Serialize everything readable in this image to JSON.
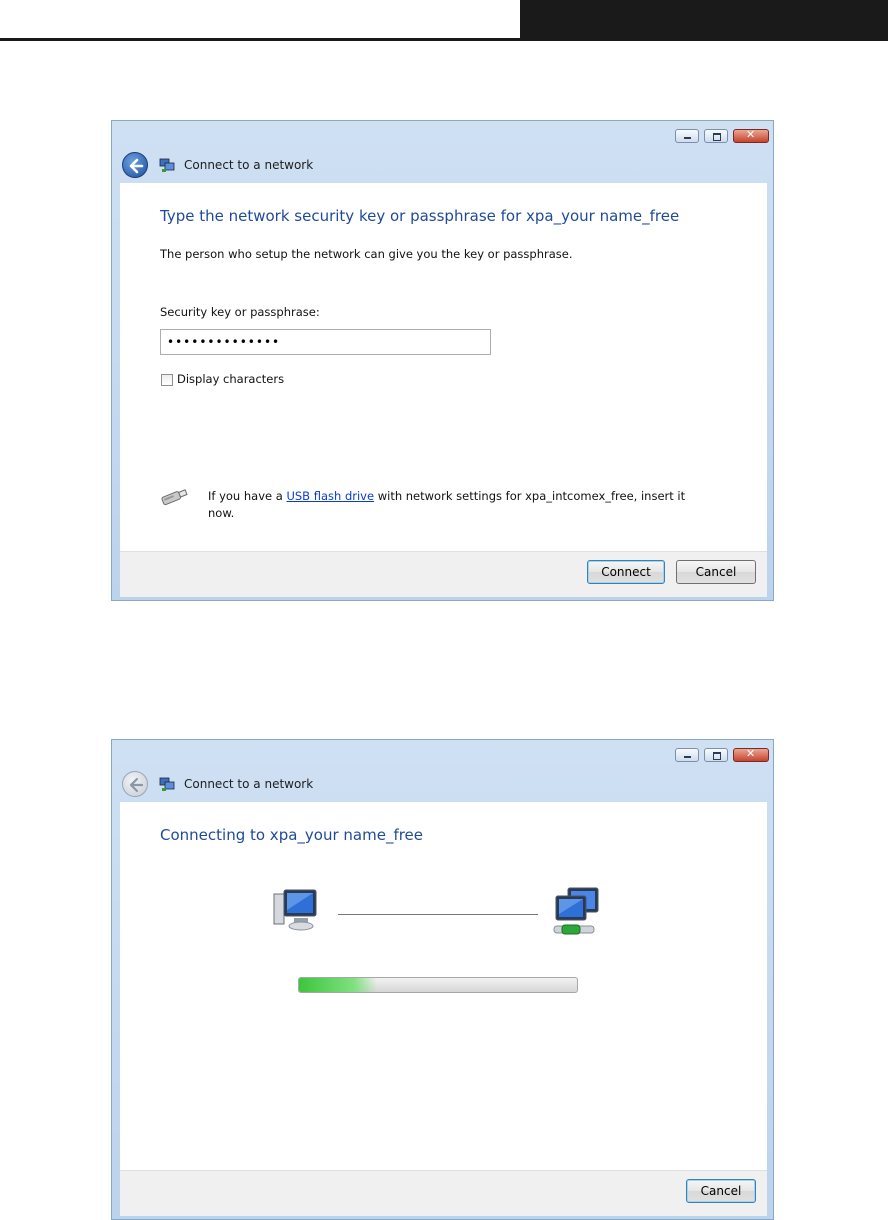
{
  "window1": {
    "title": "Connect to a network",
    "heading": "Type the network security key or passphrase for xpa_your name_free",
    "description": "The person who setup the network can give you the key or passphrase.",
    "key_label": "Security key or passphrase:",
    "key_value": "••••••••••••••",
    "display_characters_label": "Display characters",
    "usb_text_before": "If you have a ",
    "usb_link": "USB flash drive",
    "usb_text_after": " with network settings for xpa_intcomex_free, insert it",
    "usb_text_line2": "now.",
    "connect_button": "Connect",
    "cancel_button": "Cancel"
  },
  "window2": {
    "title": "Connect to a network",
    "heading": "Connecting to xpa_your name_free",
    "progress": 0.28,
    "cancel_button": "Cancel"
  },
  "icons": {
    "back": "back-arrow-icon",
    "network": "network-icon",
    "usb": "usb-drive-icon",
    "computer": "computer-icon",
    "network_computers": "network-computers-icon"
  },
  "colors": {
    "heading": "#1f4a9a",
    "link": "#0a3bd6",
    "progress_fill": "#3ec53e"
  }
}
